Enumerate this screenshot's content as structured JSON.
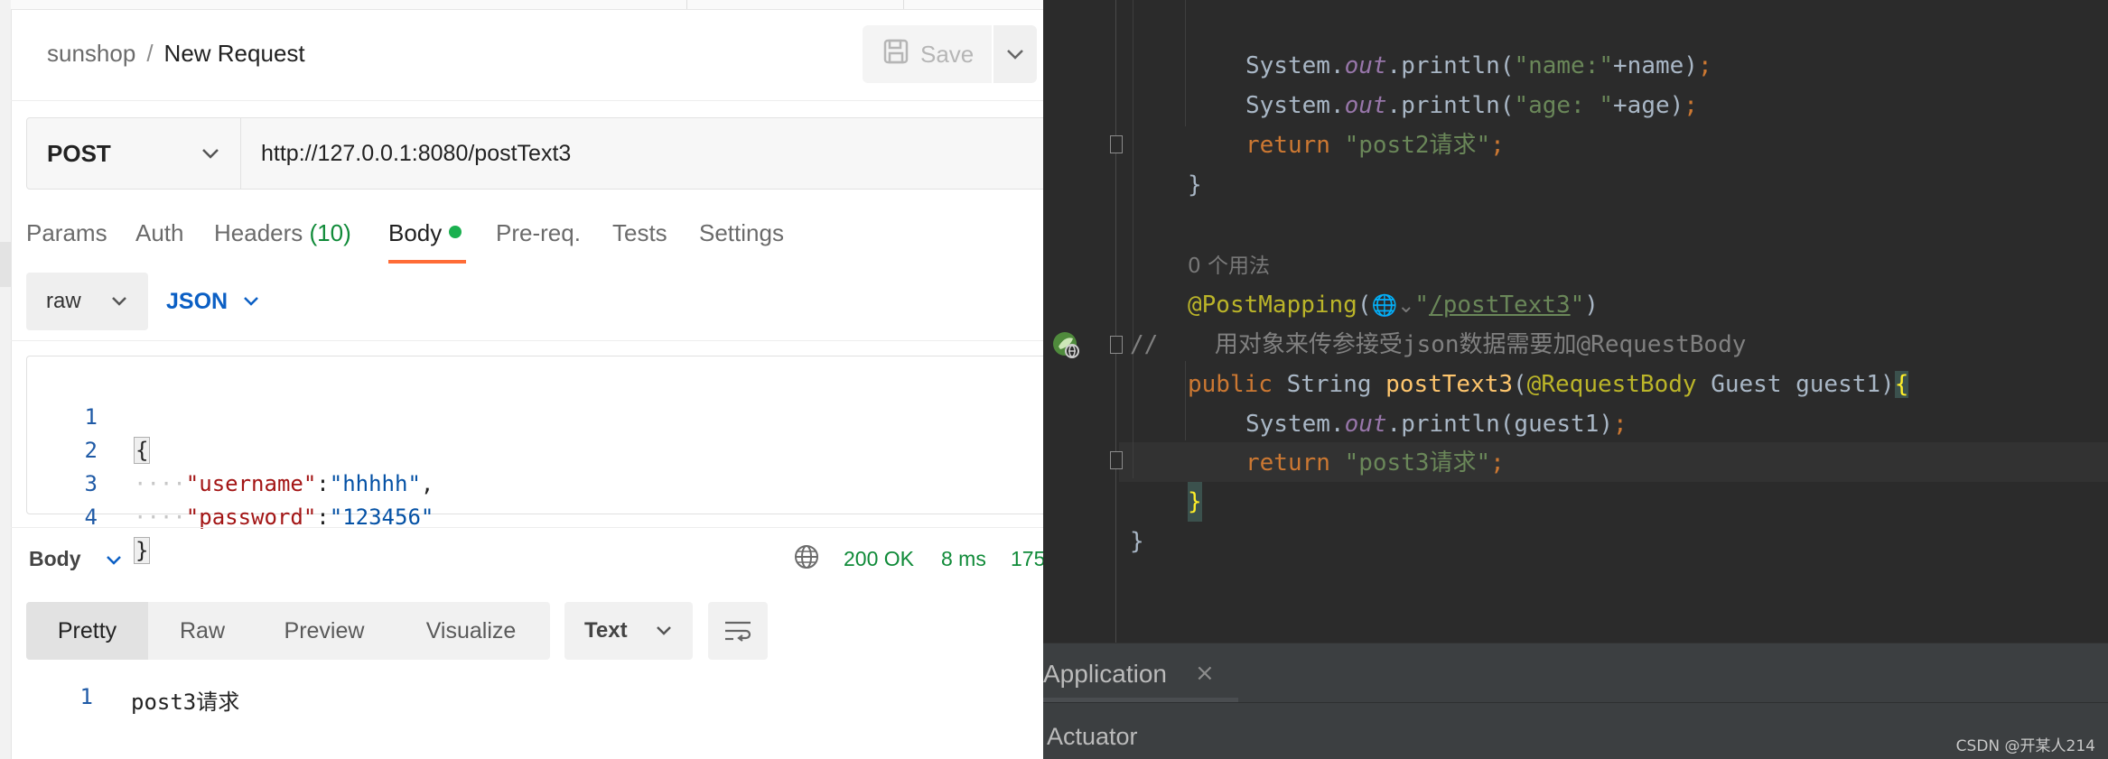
{
  "postman": {
    "breadcrumb": {
      "collection": "sunshop",
      "separator": "/",
      "request_name": "New Request"
    },
    "save_label": "Save",
    "method": "POST",
    "url": "http://127.0.0.1:8080/postText3",
    "tabs": [
      {
        "label": "Params"
      },
      {
        "label": "Auth"
      },
      {
        "label": "Headers",
        "count": "(10)"
      },
      {
        "label": "Body",
        "active": true
      },
      {
        "label": "Pre-req."
      },
      {
        "label": "Tests"
      },
      {
        "label": "Settings"
      }
    ],
    "body_mode": "raw",
    "body_format": "JSON",
    "request_body_lines": [
      {
        "num": "1",
        "text": "{"
      },
      {
        "num": "2",
        "indent": "····",
        "key": "\"username\"",
        "colon": ":",
        "value": "\"hhhhh\"",
        "trail": ","
      },
      {
        "num": "3",
        "indent": "····",
        "key": "\"password\"",
        "colon": ":",
        "value": "\"123456\"",
        "trail": ""
      },
      {
        "num": "4",
        "text": "}"
      }
    ],
    "response": {
      "title": "Body",
      "status": "200 OK",
      "time": "8 ms",
      "size": "175",
      "views": [
        "Pretty",
        "Raw",
        "Preview",
        "Visualize"
      ],
      "active_view": "Pretty",
      "format": "Text",
      "lines": [
        {
          "num": "1",
          "text": "post3请求"
        }
      ]
    },
    "colors": {
      "accent_orange": "#ff6c37",
      "status_green": "#0f8a38",
      "json_blue": "#0b5fc4"
    }
  },
  "ide": {
    "code": {
      "l1": {
        "pre": "System.",
        "out": "out",
        "mid": ".println(",
        "str": "\"name:\"",
        "post": "+name)",
        "semi": ";"
      },
      "l2": {
        "pre": "System.",
        "out": "out",
        "mid": ".println(",
        "str": "\"age: \"",
        "post": "+age)",
        "semi": ";"
      },
      "l3": {
        "kw": "return ",
        "str": "\"post2请求\"",
        "semi": ";"
      },
      "l4": {
        "text": "}"
      },
      "l5": {
        "hint": "0 个用法"
      },
      "l6": {
        "ann": "@PostMapping",
        "open": "(",
        "hint": "🌐⌄",
        "q1": "\"",
        "path": "/postText3",
        "q2": "\"",
        "close": ")"
      },
      "l7": {
        "comment": "//    用对象来传参接受json数据需要加@RequestBody"
      },
      "l8": {
        "kw": "public ",
        "type": "String ",
        "fn": "postText3",
        "open": "(",
        "ann": "@RequestBody",
        "rest": " Guest guest1)",
        "brace": "{"
      },
      "l9": {
        "pre": "System.",
        "out": "out",
        "mid": ".println(guest1)",
        "semi": ";"
      },
      "l10": {
        "kw": "return ",
        "str": "\"post3请求\"",
        "semi": ";"
      },
      "l11": {
        "text": "}"
      },
      "l12": {
        "text": "}"
      }
    },
    "tool_window": {
      "tab": "Application",
      "close": "×",
      "panel": "Actuator"
    },
    "watermark": "CSDN @开某人214"
  }
}
